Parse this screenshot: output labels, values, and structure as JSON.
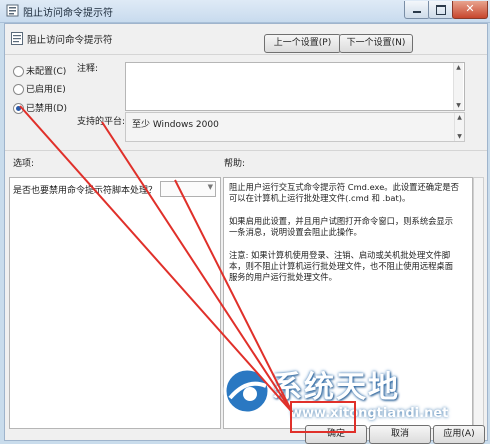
{
  "window": {
    "title": "阻止访问命令提示符",
    "controls": {
      "minimize": "–",
      "maximize": "□",
      "close": "✕"
    }
  },
  "header": {
    "policy_title": "阻止访问命令提示符",
    "prev_label": "上一个设置(P)",
    "next_label": "下一个设置(N)"
  },
  "state": {
    "options": [
      {
        "label": "未配置(C)",
        "selected": false
      },
      {
        "label": "已启用(E)",
        "selected": false
      },
      {
        "label": "已禁用(D)",
        "selected": true
      }
    ]
  },
  "comment": {
    "label": "注释:",
    "value": ""
  },
  "platform": {
    "label": "支持的平台:",
    "value": "至少 Windows 2000"
  },
  "options_section": {
    "label": "选项:",
    "item_text": "是否也要禁用命令提示符脚本处理？",
    "select_value": ""
  },
  "help_section": {
    "label": "帮助:",
    "paragraphs": [
      "阻止用户运行交互式命令提示符 Cmd.exe。此设置还确定是否可以在计算机上运行批处理文件(.cmd 和 .bat)。",
      "如果启用此设置，并且用户试图打开命令窗口，则系统会显示一条消息，说明设置会阻止此操作。",
      "注意: 如果计算机使用登录、注销、启动或关机批处理文件脚本，则不阻止计算机运行批处理文件，也不阻止使用远程桌面服务的用户运行批处理文件。"
    ]
  },
  "footer": {
    "ok_label": "确定",
    "cancel_label": "取消",
    "apply_label": "应用(A)"
  },
  "watermark": {
    "text": "系统天地",
    "url": "www.xitongtiandi.net"
  },
  "annotation_color": "#e0302a",
  "icons": {
    "window": "policy-setting-icon",
    "policy": "policy-setting-icon"
  }
}
